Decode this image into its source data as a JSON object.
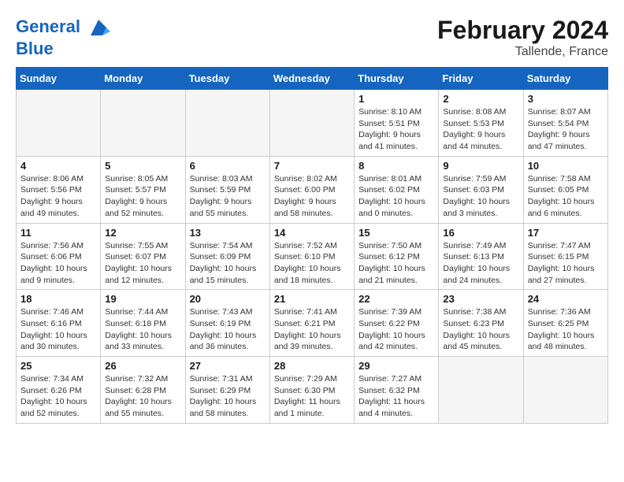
{
  "header": {
    "logo_line1": "General",
    "logo_line2": "Blue",
    "month_year": "February 2024",
    "location": "Tallende, France"
  },
  "weekdays": [
    "Sunday",
    "Monday",
    "Tuesday",
    "Wednesday",
    "Thursday",
    "Friday",
    "Saturday"
  ],
  "weeks": [
    [
      {
        "day": "",
        "info": ""
      },
      {
        "day": "",
        "info": ""
      },
      {
        "day": "",
        "info": ""
      },
      {
        "day": "",
        "info": ""
      },
      {
        "day": "1",
        "info": "Sunrise: 8:10 AM\nSunset: 5:51 PM\nDaylight: 9 hours\nand 41 minutes."
      },
      {
        "day": "2",
        "info": "Sunrise: 8:08 AM\nSunset: 5:53 PM\nDaylight: 9 hours\nand 44 minutes."
      },
      {
        "day": "3",
        "info": "Sunrise: 8:07 AM\nSunset: 5:54 PM\nDaylight: 9 hours\nand 47 minutes."
      }
    ],
    [
      {
        "day": "4",
        "info": "Sunrise: 8:06 AM\nSunset: 5:56 PM\nDaylight: 9 hours\nand 49 minutes."
      },
      {
        "day": "5",
        "info": "Sunrise: 8:05 AM\nSunset: 5:57 PM\nDaylight: 9 hours\nand 52 minutes."
      },
      {
        "day": "6",
        "info": "Sunrise: 8:03 AM\nSunset: 5:59 PM\nDaylight: 9 hours\nand 55 minutes."
      },
      {
        "day": "7",
        "info": "Sunrise: 8:02 AM\nSunset: 6:00 PM\nDaylight: 9 hours\nand 58 minutes."
      },
      {
        "day": "8",
        "info": "Sunrise: 8:01 AM\nSunset: 6:02 PM\nDaylight: 10 hours\nand 0 minutes."
      },
      {
        "day": "9",
        "info": "Sunrise: 7:59 AM\nSunset: 6:03 PM\nDaylight: 10 hours\nand 3 minutes."
      },
      {
        "day": "10",
        "info": "Sunrise: 7:58 AM\nSunset: 6:05 PM\nDaylight: 10 hours\nand 6 minutes."
      }
    ],
    [
      {
        "day": "11",
        "info": "Sunrise: 7:56 AM\nSunset: 6:06 PM\nDaylight: 10 hours\nand 9 minutes."
      },
      {
        "day": "12",
        "info": "Sunrise: 7:55 AM\nSunset: 6:07 PM\nDaylight: 10 hours\nand 12 minutes."
      },
      {
        "day": "13",
        "info": "Sunrise: 7:54 AM\nSunset: 6:09 PM\nDaylight: 10 hours\nand 15 minutes."
      },
      {
        "day": "14",
        "info": "Sunrise: 7:52 AM\nSunset: 6:10 PM\nDaylight: 10 hours\nand 18 minutes."
      },
      {
        "day": "15",
        "info": "Sunrise: 7:50 AM\nSunset: 6:12 PM\nDaylight: 10 hours\nand 21 minutes."
      },
      {
        "day": "16",
        "info": "Sunrise: 7:49 AM\nSunset: 6:13 PM\nDaylight: 10 hours\nand 24 minutes."
      },
      {
        "day": "17",
        "info": "Sunrise: 7:47 AM\nSunset: 6:15 PM\nDaylight: 10 hours\nand 27 minutes."
      }
    ],
    [
      {
        "day": "18",
        "info": "Sunrise: 7:46 AM\nSunset: 6:16 PM\nDaylight: 10 hours\nand 30 minutes."
      },
      {
        "day": "19",
        "info": "Sunrise: 7:44 AM\nSunset: 6:18 PM\nDaylight: 10 hours\nand 33 minutes."
      },
      {
        "day": "20",
        "info": "Sunrise: 7:43 AM\nSunset: 6:19 PM\nDaylight: 10 hours\nand 36 minutes."
      },
      {
        "day": "21",
        "info": "Sunrise: 7:41 AM\nSunset: 6:21 PM\nDaylight: 10 hours\nand 39 minutes."
      },
      {
        "day": "22",
        "info": "Sunrise: 7:39 AM\nSunset: 6:22 PM\nDaylight: 10 hours\nand 42 minutes."
      },
      {
        "day": "23",
        "info": "Sunrise: 7:38 AM\nSunset: 6:23 PM\nDaylight: 10 hours\nand 45 minutes."
      },
      {
        "day": "24",
        "info": "Sunrise: 7:36 AM\nSunset: 6:25 PM\nDaylight: 10 hours\nand 48 minutes."
      }
    ],
    [
      {
        "day": "25",
        "info": "Sunrise: 7:34 AM\nSunset: 6:26 PM\nDaylight: 10 hours\nand 52 minutes."
      },
      {
        "day": "26",
        "info": "Sunrise: 7:32 AM\nSunset: 6:28 PM\nDaylight: 10 hours\nand 55 minutes."
      },
      {
        "day": "27",
        "info": "Sunrise: 7:31 AM\nSunset: 6:29 PM\nDaylight: 10 hours\nand 58 minutes."
      },
      {
        "day": "28",
        "info": "Sunrise: 7:29 AM\nSunset: 6:30 PM\nDaylight: 11 hours\nand 1 minute."
      },
      {
        "day": "29",
        "info": "Sunrise: 7:27 AM\nSunset: 6:32 PM\nDaylight: 11 hours\nand 4 minutes."
      },
      {
        "day": "",
        "info": ""
      },
      {
        "day": "",
        "info": ""
      }
    ]
  ]
}
